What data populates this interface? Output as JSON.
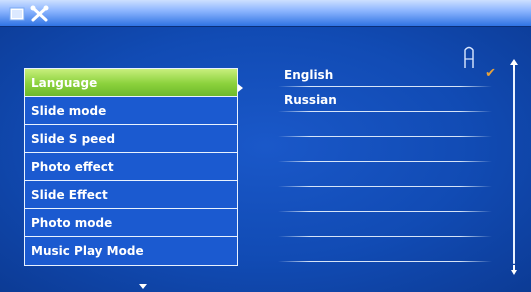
{
  "toolbar": {
    "icons": [
      "photo-icon",
      "settings-icon"
    ]
  },
  "menu": {
    "items": [
      {
        "label": "Language",
        "selected": true
      },
      {
        "label": "Slide mode"
      },
      {
        "label": "Slide S peed"
      },
      {
        "label": "Photo effect"
      },
      {
        "label": "Slide Effect"
      },
      {
        "label": "Photo mode"
      },
      {
        "label": "Music Play Mode"
      }
    ]
  },
  "options": {
    "items": [
      {
        "label": "English",
        "checked": true
      },
      {
        "label": "Russian"
      },
      {
        "label": ""
      },
      {
        "label": ""
      },
      {
        "label": ""
      },
      {
        "label": ""
      },
      {
        "label": ""
      },
      {
        "label": ""
      }
    ]
  },
  "colors": {
    "accent_selected": "#8bd13c",
    "background": "#114bb4",
    "check": "#e7a23a"
  }
}
